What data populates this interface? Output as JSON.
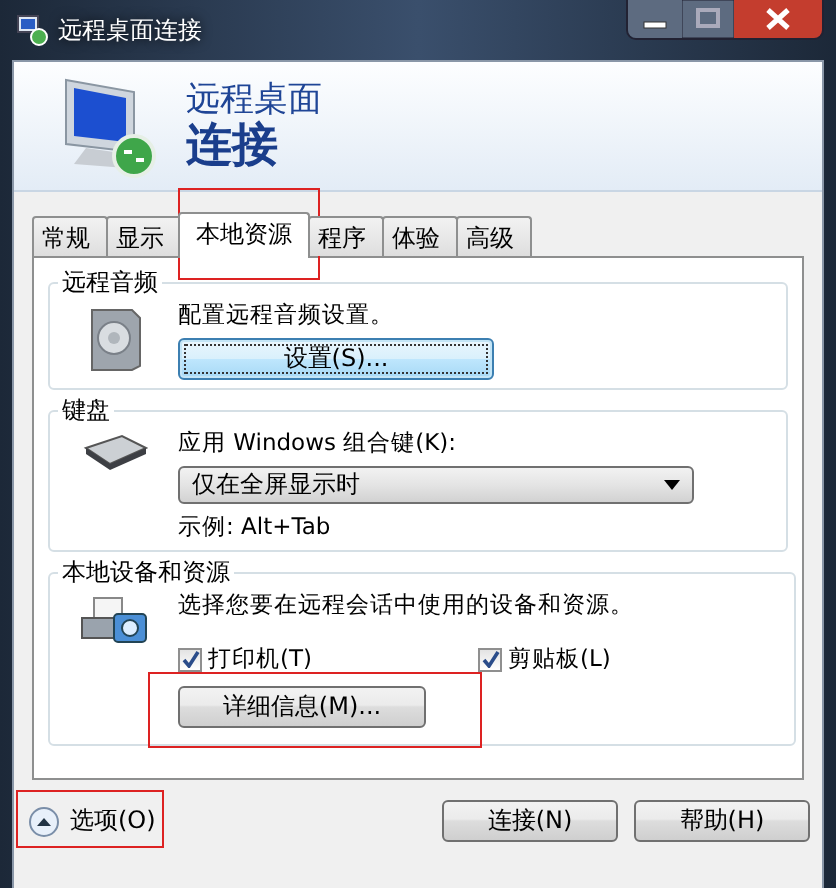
{
  "window": {
    "title": "远程桌面连接"
  },
  "header": {
    "line1": "远程桌面",
    "line2": "连接"
  },
  "tabs": [
    {
      "label": "常规",
      "selected": false,
      "highlighted": false
    },
    {
      "label": "显示",
      "selected": false,
      "highlighted": false
    },
    {
      "label": "本地资源",
      "selected": true,
      "highlighted": true
    },
    {
      "label": "程序",
      "selected": false,
      "highlighted": false
    },
    {
      "label": "体验",
      "selected": false,
      "highlighted": false
    },
    {
      "label": "高级",
      "selected": false,
      "highlighted": false
    }
  ],
  "groups": [
    {
      "kind": "audio",
      "title": "远程音频",
      "description": "配置远程音频设置。",
      "button": {
        "label": "设置(S)...",
        "highlighted": false
      }
    },
    {
      "kind": "keyboard",
      "title": "键盘",
      "label": "应用 Windows 组合键(K):",
      "dropdown": {
        "value": "仅在全屏显示时"
      },
      "example": "示例: Alt+Tab"
    },
    {
      "kind": "devices",
      "title": "本地设备和资源",
      "description": "选择您要在远程会话中使用的设备和资源。",
      "checkboxes": [
        {
          "label": "打印机(T)",
          "checked": true
        },
        {
          "label": "剪贴板(L)",
          "checked": true
        }
      ],
      "button": {
        "label": "详细信息(M)...",
        "highlighted": true
      }
    }
  ],
  "footer": {
    "options": {
      "label": "选项(O)",
      "highlighted": true
    },
    "buttons": [
      "连接(N)",
      "帮助(H)"
    ]
  }
}
